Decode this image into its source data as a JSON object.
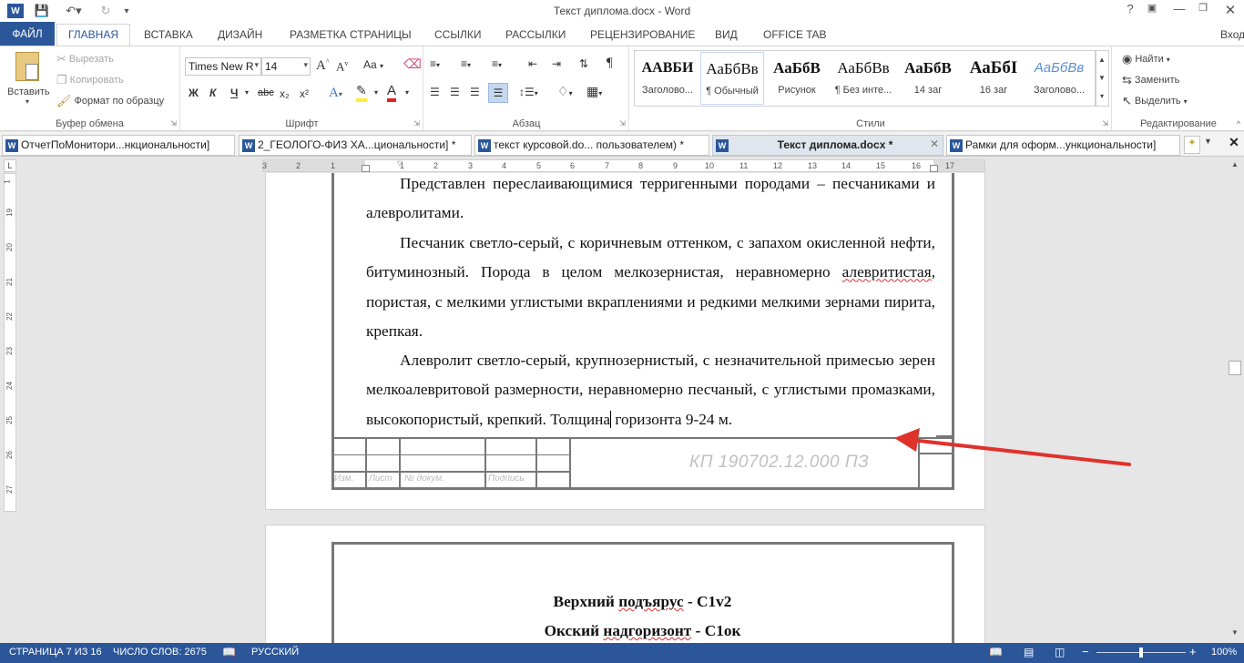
{
  "window": {
    "title": "Текст диплома.docx - Word",
    "help": "?",
    "signin": "Вход"
  },
  "ribbon_tabs": [
    "ФАЙЛ",
    "ГЛАВНАЯ",
    "ВСТАВКА",
    "ДИЗАЙН",
    "РАЗМЕТКА СТРАНИЦЫ",
    "ССЫЛКИ",
    "РАССЫЛКИ",
    "РЕЦЕНЗИРОВАНИЕ",
    "ВИД",
    "OFFICE TAB"
  ],
  "clipboard": {
    "paste": "Вставить",
    "cut": "Вырезать",
    "copy": "Копировать",
    "format_painter": "Формат по образцу",
    "group": "Буфер обмена"
  },
  "font": {
    "name": "Times New R",
    "size": "14",
    "group": "Шрифт",
    "bold": "Ж",
    "italic": "К",
    "underline": "Ч",
    "strike": "abc",
    "sub": "x₂",
    "sup": "x²",
    "case": "Aa"
  },
  "paragraph": {
    "group": "Абзац"
  },
  "styles": {
    "group": "Стили",
    "items": [
      {
        "preview": "АABБИ",
        "name": "Заголово..."
      },
      {
        "preview": "АаБбВв",
        "name": "¶ Обычный"
      },
      {
        "preview": "АаБбВ",
        "name": "Рисунок"
      },
      {
        "preview": "АаБбВв",
        "name": "¶ Без инте..."
      },
      {
        "preview": "АаБбВ",
        "name": "14 заг"
      },
      {
        "preview": "АаБбI",
        "name": "16 заг"
      },
      {
        "preview": "АаБбВв",
        "name": "Заголово..."
      }
    ]
  },
  "editing": {
    "find": "Найти",
    "replace": "Заменить",
    "select": "Выделить",
    "group": "Редактирование"
  },
  "doc_tabs": [
    "ОтчетПоМонитори...нкциональности]",
    "2_ГЕОЛОГО-ФИЗ ХА...циональности] *",
    "текст курсовой.do... пользователем) *",
    "Текст диплома.docx *",
    "Рамки для оформ...ункциональности]"
  ],
  "ruler_h": [
    "3",
    "2",
    "1",
    "1",
    "2",
    "3",
    "4",
    "5",
    "6",
    "7",
    "8",
    "9",
    "10",
    "11",
    "12",
    "13",
    "14",
    "15",
    "16",
    "17"
  ],
  "ruler_v": [
    "1",
    "19",
    "20",
    "21",
    "22",
    "23",
    "24",
    "25",
    "26",
    "27"
  ],
  "document": {
    "p1": "Представлен переслаивающимися терригенными породами – песчаниками и алевролитами.",
    "p2a": "Песчаник светло-серый, с коричневым оттенком, с запахом окисленной нефти, битуминозный. Порода в целом мелкозернистая, неравномерно",
    "p2_underlined": "алевритистая",
    "p2b": ", пористая, с мелкими углистыми вкраплениями и редкими мелкими зернами пирита, крепкая.",
    "p3a": "Алевролит светло-серый, крупнозернистый, с незначительной примесью зерен мелкоалевритовой размерности, неравномерно песчаный, с углистыми промазками, высокопористый, крепкий. Толщина",
    "p3b": " горизонта 9-24 м.",
    "stamp": {
      "izm": "Изм.",
      "list": "Лист",
      "doc": "№ докум.",
      "sign": "Подпись",
      "code": "КП 190702.12.000 ПЗ"
    },
    "page2_line1_a": "Верхний ",
    "page2_line1_u": "подъярус",
    "page2_line1_b": " - C1v2",
    "page2_line2_a": "Окский ",
    "page2_line2_u": "надгоризонт",
    "page2_line2_b": " - C1ок"
  },
  "status": {
    "page": "СТРАНИЦА 7 ИЗ 16",
    "words": "ЧИСЛО СЛОВ: 2675",
    "lang": "РУССКИЙ",
    "zoom": "100%",
    "zoom_level": 1.0
  },
  "colors": {
    "accent": "#2b579a",
    "arrow": "#e0322d"
  }
}
